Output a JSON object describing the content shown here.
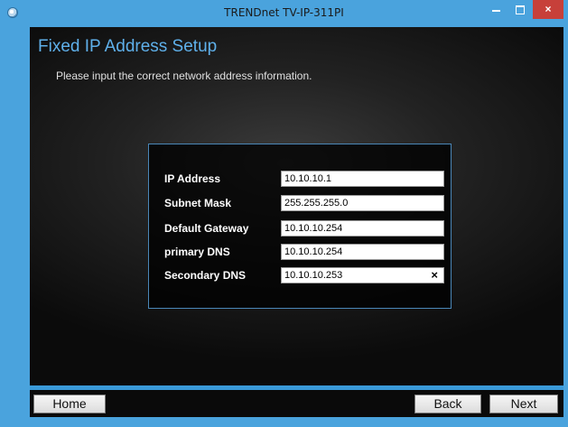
{
  "window": {
    "title": "TRENDnet TV-IP-311PI",
    "controls": {
      "minimize": "minimize",
      "maximize": "maximize",
      "close": "×"
    }
  },
  "page": {
    "title": "Fixed IP Address Setup",
    "subtitle": "Please input the correct network address information."
  },
  "form": {
    "fields": [
      {
        "label": "IP Address",
        "value": "10.10.10.1"
      },
      {
        "label": "Subnet Mask",
        "value": "255.255.255.0"
      },
      {
        "label": "Default Gateway",
        "value": "10.10.10.254"
      },
      {
        "label": "primary DNS",
        "value": "10.10.10.254"
      },
      {
        "label": "Secondary DNS",
        "value": "10.10.10.253",
        "clear_icon": "×"
      }
    ]
  },
  "buttons": {
    "home": "Home",
    "back": "Back",
    "next": "Next"
  },
  "colors": {
    "titlebar": "#4aa3dd",
    "close_button": "#c7403a",
    "heading": "#5fb0ea",
    "panel_border": "#4a87b8"
  }
}
